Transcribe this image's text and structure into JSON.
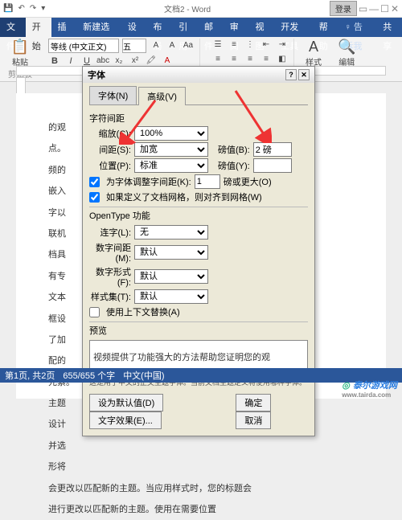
{
  "window": {
    "title": "文档2 - Word",
    "login": "登录"
  },
  "menu": {
    "file": "文件",
    "home": "开始",
    "insert": "插入",
    "addin": "新建选项卡",
    "design": "设计",
    "layout": "布局",
    "ref": "引用",
    "mail": "邮件",
    "review": "审阅",
    "view": "视图",
    "dev": "开发工具",
    "help": "帮助",
    "tellme": "告诉我",
    "share": "共享"
  },
  "ribbon": {
    "font_name": "等线 (中文正文)",
    "font_size": "五",
    "paste": "粘贴",
    "clipboard": "剪贴板",
    "styles": "样式",
    "editing": "编辑"
  },
  "doc_lines": [
    "",
    "的观",
    "点。",
    "频的",
    "嵌入",
    "字以",
    "联机",
    "档具",
    "有专",
    "文本",
    "框设",
    "了加",
    "配的",
    "元素。",
    "主题",
    "设计",
    "并选",
    "形将",
    "会更改以匹配新的主题。当应用样式时，您的标题会",
    "进行更改以匹配新的主题。使用在需要位置"
  ],
  "dialog": {
    "title": "字体",
    "tab_font": "字体(N)",
    "tab_adv": "高级(V)",
    "section_spacing": "字符间距",
    "scale_lbl": "缩放(C):",
    "scale_val": "100%",
    "spacing_lbl": "间距(S):",
    "spacing_val": "加宽",
    "spacing_pt_lbl": "磅值(B):",
    "spacing_pt": "2 磅",
    "position_lbl": "位置(P):",
    "position_val": "标准",
    "position_pt_lbl": "磅值(Y):",
    "position_pt": "",
    "kerning": "为字体调整字间距(K):",
    "kerning_suffix": "磅或更大(O)",
    "grid": "如果定义了文档网格，则对齐到网格(W)",
    "section_ot": "OpenType 功能",
    "lig_lbl": "连字(L):",
    "lig_val": "无",
    "numspc_lbl": "数字间距(M):",
    "numspc_val": "默认",
    "numform_lbl": "数字形式(F):",
    "numform_val": "默认",
    "styset_lbl": "样式集(T):",
    "styset_val": "默认",
    "context": "使用上下文替换(A)",
    "preview_lbl": "预览",
    "preview_text": "视频提供了功能强大的方法帮助您证明您的观",
    "hint": "这是用于中文的正文主题字体。当前文档主题定义将使用哪种字体。",
    "defaults": "设为默认值(D)",
    "texteffects": "文字效果(E)...",
    "ok": "确定",
    "cancel": "取消"
  },
  "status": {
    "page": "第1页, 共2页",
    "words": "655/655 个字",
    "lang": "中文(中国)"
  },
  "watermark": "泰尔游戏网"
}
